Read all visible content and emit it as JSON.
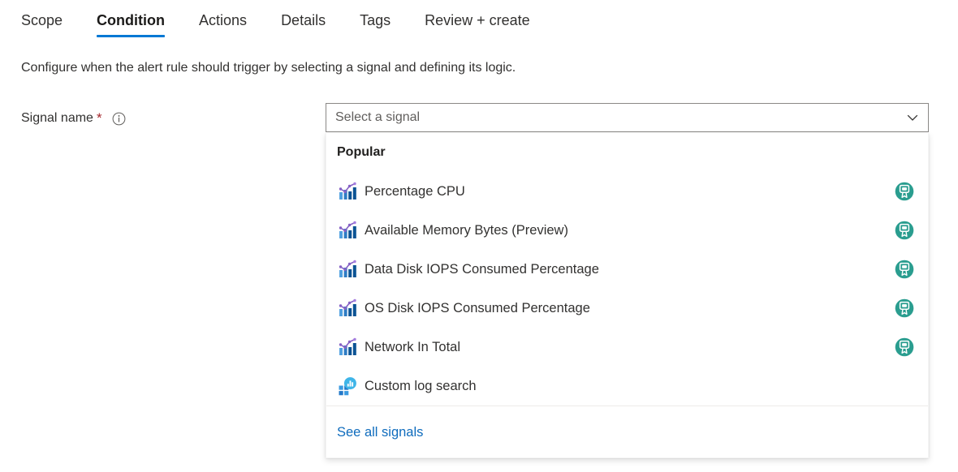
{
  "tabs": [
    {
      "label": "Scope",
      "active": false
    },
    {
      "label": "Condition",
      "active": true
    },
    {
      "label": "Actions",
      "active": false
    },
    {
      "label": "Details",
      "active": false
    },
    {
      "label": "Tags",
      "active": false
    },
    {
      "label": "Review + create",
      "active": false
    }
  ],
  "description": "Configure when the alert rule should trigger by selecting a signal and defining its logic.",
  "field": {
    "label": "Signal name",
    "required_marker": "*",
    "info_icon": "info-circle-icon"
  },
  "combo": {
    "placeholder": "Select a signal",
    "value": "",
    "caret_icon": "chevron-down-icon"
  },
  "dropdown": {
    "group_header": "Popular",
    "items": [
      {
        "label": "Percentage CPU",
        "icon": "metric-chart-icon",
        "badge": "monitor-badge-icon"
      },
      {
        "label": "Available Memory Bytes (Preview)",
        "icon": "metric-chart-icon",
        "badge": "monitor-badge-icon"
      },
      {
        "label": "Data Disk IOPS Consumed Percentage",
        "icon": "metric-chart-icon",
        "badge": "monitor-badge-icon"
      },
      {
        "label": "OS Disk IOPS Consumed Percentage",
        "icon": "metric-chart-icon",
        "badge": "monitor-badge-icon"
      },
      {
        "label": "Network In Total",
        "icon": "metric-chart-icon",
        "badge": "monitor-badge-icon"
      },
      {
        "label": "Custom log search",
        "icon": "log-search-icon",
        "badge": ""
      }
    ],
    "footer_link": "See all signals"
  },
  "colors": {
    "accent": "#0078d4",
    "link": "#0f6cbd",
    "required": "#a4262c",
    "badge_teal": "#2a9d8f",
    "icon_purple": "#8661c5",
    "icon_blue_dark": "#0b5394",
    "icon_blue_light": "#50a0e0",
    "text": "#323130",
    "placeholder": "#605e5c",
    "border": "#8a8886"
  }
}
